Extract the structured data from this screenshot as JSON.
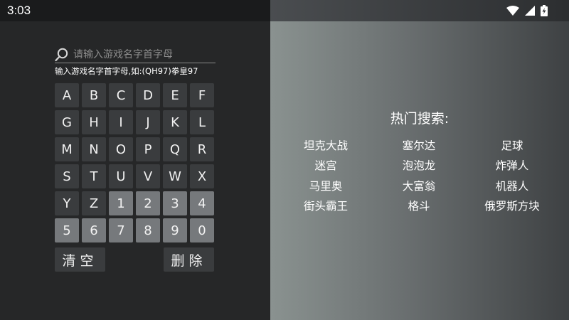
{
  "status_bar": {
    "time": "3:03",
    "icons": [
      "wifi-icon",
      "signal-icon",
      "battery-charging-icon"
    ]
  },
  "search": {
    "placeholder": "请输入游戏名字首字母",
    "value": "",
    "icon": "search-icon",
    "hint": "输入游戏名字首字母,如:(QH97)拳皇97"
  },
  "keypad": {
    "rows": [
      [
        "A",
        "B",
        "C",
        "D",
        "E",
        "F"
      ],
      [
        "G",
        "H",
        "I",
        "J",
        "K",
        "L"
      ],
      [
        "M",
        "N",
        "O",
        "P",
        "Q",
        "R"
      ],
      [
        "S",
        "T",
        "U",
        "V",
        "W",
        "X"
      ],
      [
        "Y",
        "Z",
        "1",
        "2",
        "3",
        "4"
      ],
      [
        "5",
        "6",
        "7",
        "8",
        "9",
        "0"
      ]
    ],
    "clear_label": "清空",
    "delete_label": "删除"
  },
  "hot_search": {
    "title": "热门搜索:",
    "items": [
      "坦克大战",
      "塞尔达",
      "足球",
      "迷宫",
      "泡泡龙",
      "炸弹人",
      "马里奥",
      "大富翁",
      "机器人",
      "街头霸王",
      "格斗",
      "俄罗斯方块"
    ]
  },
  "colors": {
    "key_letter_bg": "#3a3c3e",
    "key_digit_bg": "#76797c",
    "left_bg": "#262728",
    "right_gradient_start": "#8a9290",
    "right_gradient_end": "#3e4143"
  }
}
